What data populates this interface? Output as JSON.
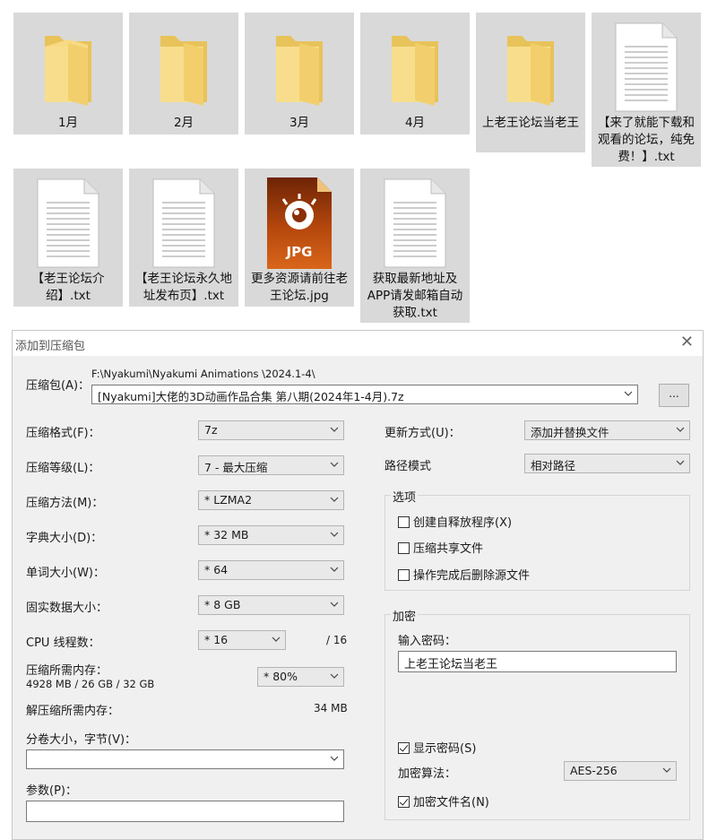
{
  "explorer": {
    "items": [
      {
        "name": "1月",
        "type": "folder"
      },
      {
        "name": "2月",
        "type": "folder"
      },
      {
        "name": "3月",
        "type": "folder"
      },
      {
        "name": "4月",
        "type": "folder"
      },
      {
        "name": "上老王论坛当老王",
        "type": "folder"
      },
      {
        "name": "【来了就能下载和观看的论坛，纯免费！】.txt",
        "type": "txt"
      },
      {
        "name": "【老王论坛介绍】.txt",
        "type": "txt"
      },
      {
        "name": "【老王论坛永久地址发布页】.txt",
        "type": "txt"
      },
      {
        "name": "更多资源请前往老王论坛.jpg",
        "type": "jpg",
        "badge": "JPG"
      },
      {
        "name": "获取最新地址及APP请发邮箱自动获取.txt",
        "type": "txt"
      }
    ]
  },
  "dialog": {
    "title": "添加到压缩包",
    "close_glyph": "✕",
    "archive_label": "压缩包(A)：",
    "archive_path": "F:\\Nyakumi\\Nyakumi Animations \\2024.1-4\\",
    "archive_name": "[Nyakumi]大佬的3D动画作品合集 第八期(2024年1-4月).7z",
    "browse_label": "...",
    "left": {
      "format_label": "压缩格式(F)：",
      "format_value": "7z",
      "level_label": "压缩等级(L)：",
      "level_value": "7 - 最大压缩",
      "method_label": "压缩方法(M)：",
      "method_value": "* LZMA2",
      "dict_label": "字典大小(D)：",
      "dict_value": "* 32 MB",
      "word_label": "单词大小(W)：",
      "word_value": "* 64",
      "solid_label": "固实数据大小：",
      "solid_value": "* 8 GB",
      "cpu_label": "CPU 线程数：",
      "cpu_value": "* 16",
      "cpu_max": "/ 16",
      "mem_label": "压缩所需内存：",
      "mem_detail": "4928 MB / 26 GB / 32 GB",
      "mem_value": "* 80%",
      "decomp_label": "解压缩所需内存：",
      "decomp_value": "34 MB",
      "volume_label": "分卷大小，字节(V)：",
      "volume_value": "",
      "params_label": "参数(P)：",
      "params_value": ""
    },
    "right": {
      "update_label": "更新方式(U)：",
      "update_value": "添加并替换文件",
      "path_label": "路径模式",
      "path_value": "相对路径",
      "options_title": "选项",
      "opt_sfx": "创建自释放程序(X)",
      "opt_shared": "压缩共享文件",
      "opt_delete": "操作完成后删除源文件",
      "enc_title": "加密",
      "pwd_label": "输入密码：",
      "pwd_value": "上老王论坛当老王",
      "show_pwd": "显示密码(S)",
      "enc_method_label": "加密算法：",
      "enc_method_value": "AES-256",
      "enc_names": "加密文件名(N)"
    }
  },
  "colors": {
    "tile_bg": "#d9d9d9",
    "dialog_bg": "#f0f0f0",
    "folder": "#f5d77a",
    "jpg_top": "#7a2b07"
  }
}
